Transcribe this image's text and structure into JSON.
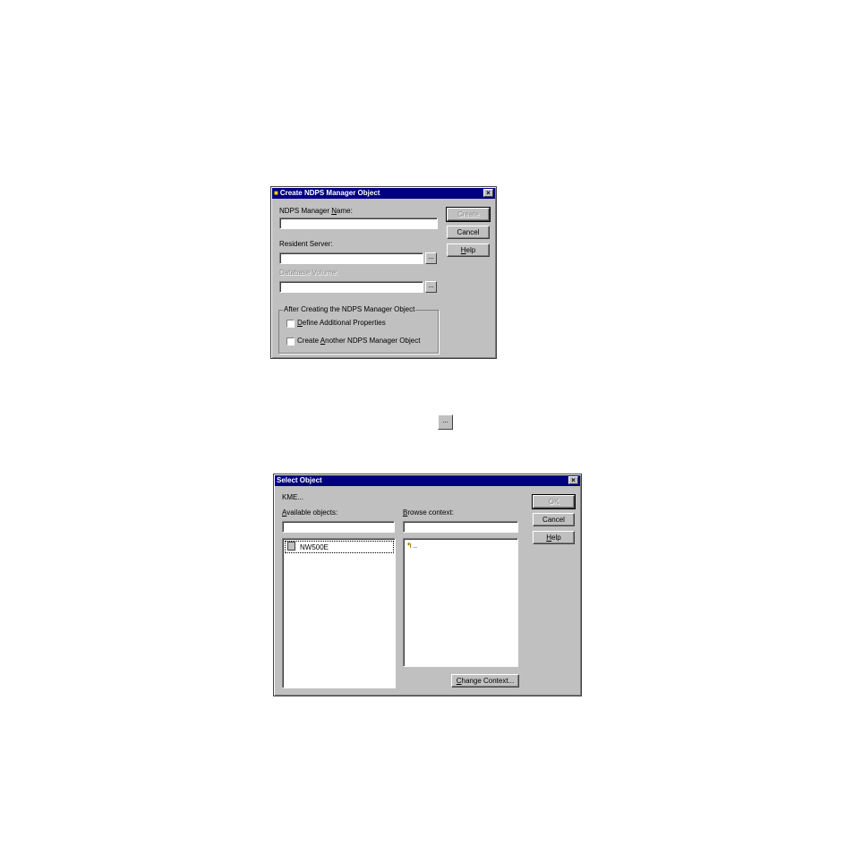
{
  "create_dialog": {
    "title": "Create NDPS Manager Object",
    "close_glyph": "×",
    "manager_name_label": "NDPS Manager Name:",
    "manager_name_value": "",
    "resident_server_label": "Resident Server:",
    "resident_server_value": "",
    "database_volume_label": "Database Volume:",
    "database_volume_value": "",
    "browse_glyph": "...",
    "create_button": "Create",
    "cancel_button": "Cancel",
    "help_button": "Help",
    "group_title": "After Creating the NDPS Manager Object",
    "option_define": "Define Additional Properties",
    "option_create_another": "Create Another NDPS Manager Object"
  },
  "standalone_browse_glyph": "...",
  "select_dialog": {
    "title": "Select Object",
    "close_glyph": "×",
    "context_path": "KME...",
    "available_label": "Available objects:",
    "browse_label": "Browse context:",
    "available_items": [
      "NW500E"
    ],
    "browse_items": [
      ".."
    ],
    "ok_button": "OK",
    "cancel_button": "Cancel",
    "help_button": "Help",
    "change_context_button": "Change Context..."
  },
  "icons": {
    "title_icon": "ndps-printer-icon",
    "server_icon": "server-icon",
    "parent_icon": "up-arrow-folder-icon"
  }
}
